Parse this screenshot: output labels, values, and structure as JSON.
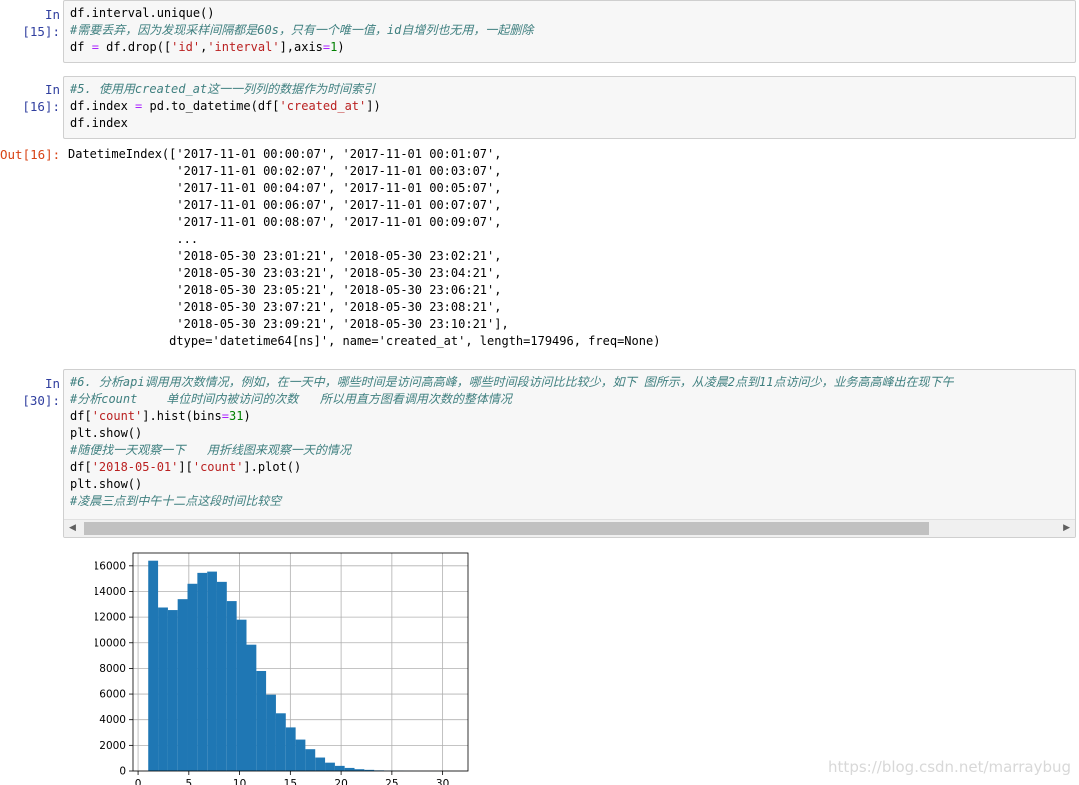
{
  "cells": [
    {
      "prompt": "In [15]:",
      "lines": [
        [
          {
            "t": "df.interval.unique()",
            "c": ""
          }
        ],
        [
          {
            "t": "#需要丢弃，因为发现采样间隔都是60s，只有一个唯一值，id自增列也无用，一起删除",
            "c": "cm"
          }
        ],
        [
          {
            "t": "df ",
            "c": ""
          },
          {
            "t": "=",
            "c": "op"
          },
          {
            "t": " df.drop([",
            "c": ""
          },
          {
            "t": "'id'",
            "c": "st"
          },
          {
            "t": ",",
            "c": ""
          },
          {
            "t": "'interval'",
            "c": "st"
          },
          {
            "t": "],axis",
            "c": ""
          },
          {
            "t": "=",
            "c": "op"
          },
          {
            "t": "1",
            "c": "nu"
          },
          {
            "t": ")",
            "c": ""
          }
        ]
      ]
    },
    {
      "prompt": "In [16]:",
      "lines": [
        [
          {
            "t": "#5. 使用用created_at这一一列列的数据作为时间索引",
            "c": "cm"
          }
        ],
        [
          {
            "t": "df.index ",
            "c": ""
          },
          {
            "t": "=",
            "c": "op"
          },
          {
            "t": " pd.to_datetime(df[",
            "c": ""
          },
          {
            "t": "'created_at'",
            "c": "st"
          },
          {
            "t": "])",
            "c": ""
          }
        ],
        [
          {
            "t": "df.index",
            "c": ""
          }
        ]
      ]
    },
    {
      "prompt": "In [30]:",
      "lines": [
        [
          {
            "t": "#6. 分析api调用用次数情况，例如，在一天中，哪些时间是访问高高峰，哪些时间段访问比比较少，如下 图所示，从凌晨2点到11点访问少，业务高高峰出在现下午",
            "c": "cm"
          }
        ],
        [
          {
            "t": "#分析count    单位时间内被访问的次数   所以用直方图看调用次数的整体情况",
            "c": "cm"
          }
        ],
        [
          {
            "t": "df[",
            "c": ""
          },
          {
            "t": "'count'",
            "c": "st"
          },
          {
            "t": "].hist(bins",
            "c": ""
          },
          {
            "t": "=",
            "c": "op"
          },
          {
            "t": "31",
            "c": "nu"
          },
          {
            "t": ")",
            "c": ""
          }
        ],
        [
          {
            "t": "plt.show()",
            "c": ""
          }
        ],
        [
          {
            "t": "#随便找一天观察一下   用折线图来观察一天的情况",
            "c": "cm"
          }
        ],
        [
          {
            "t": "df[",
            "c": ""
          },
          {
            "t": "'2018-05-01'",
            "c": "st"
          },
          {
            "t": "][",
            "c": ""
          },
          {
            "t": "'count'",
            "c": "st"
          },
          {
            "t": "].plot()",
            "c": ""
          }
        ],
        [
          {
            "t": "plt.show()",
            "c": ""
          }
        ],
        [
          {
            "t": "#凌晨三点到中午十二点这段时间比较空",
            "c": "cm"
          }
        ]
      ]
    }
  ],
  "output16": {
    "prompt": "Out[16]:",
    "lines": [
      "DatetimeIndex(['2017-11-01 00:00:07', '2017-11-01 00:01:07',",
      "               '2017-11-01 00:02:07', '2017-11-01 00:03:07',",
      "               '2017-11-01 00:04:07', '2017-11-01 00:05:07',",
      "               '2017-11-01 00:06:07', '2017-11-01 00:07:07',",
      "               '2017-11-01 00:08:07', '2017-11-01 00:09:07',",
      "               ...",
      "               '2018-05-30 23:01:21', '2018-05-30 23:02:21',",
      "               '2018-05-30 23:03:21', '2018-05-30 23:04:21',",
      "               '2018-05-30 23:05:21', '2018-05-30 23:06:21',",
      "               '2018-05-30 23:07:21', '2018-05-30 23:08:21',",
      "               '2018-05-30 23:09:21', '2018-05-30 23:10:21'],",
      "              dtype='datetime64[ns]', name='created_at', length=179496, freq=None)"
    ]
  },
  "scrollbar": {
    "left_arrow": "◀",
    "right_arrow": "▶"
  },
  "watermark": "https://blog.csdn.net/marraybug",
  "colors": {
    "bar": "#1f77b4",
    "grid": "#b0b0b0"
  },
  "chart_data": {
    "type": "bar",
    "title": "",
    "xlabel": "",
    "ylabel": "",
    "bins": [
      {
        "x0": 1.0,
        "x1": 1.97,
        "count": 16400
      },
      {
        "x0": 1.97,
        "x1": 2.94,
        "count": 12750
      },
      {
        "x0": 2.94,
        "x1": 3.9,
        "count": 12550
      },
      {
        "x0": 3.9,
        "x1": 4.87,
        "count": 13400
      },
      {
        "x0": 4.87,
        "x1": 5.84,
        "count": 14600
      },
      {
        "x0": 5.84,
        "x1": 6.81,
        "count": 15450
      },
      {
        "x0": 6.81,
        "x1": 7.77,
        "count": 15550
      },
      {
        "x0": 7.77,
        "x1": 8.74,
        "count": 14750
      },
      {
        "x0": 8.74,
        "x1": 9.71,
        "count": 13250
      },
      {
        "x0": 9.71,
        "x1": 10.68,
        "count": 11800
      },
      {
        "x0": 10.68,
        "x1": 11.65,
        "count": 9850
      },
      {
        "x0": 11.65,
        "x1": 12.61,
        "count": 7800
      },
      {
        "x0": 12.61,
        "x1": 13.58,
        "count": 5950
      },
      {
        "x0": 13.58,
        "x1": 14.55,
        "count": 4500
      },
      {
        "x0": 14.55,
        "x1": 15.52,
        "count": 3400
      },
      {
        "x0": 15.52,
        "x1": 16.48,
        "count": 2450
      },
      {
        "x0": 16.48,
        "x1": 17.45,
        "count": 1700
      },
      {
        "x0": 17.45,
        "x1": 18.42,
        "count": 1050
      },
      {
        "x0": 18.42,
        "x1": 19.39,
        "count": 650
      },
      {
        "x0": 19.39,
        "x1": 20.35,
        "count": 400
      },
      {
        "x0": 20.35,
        "x1": 21.32,
        "count": 240
      },
      {
        "x0": 21.32,
        "x1": 22.29,
        "count": 140
      },
      {
        "x0": 22.29,
        "x1": 23.26,
        "count": 90
      },
      {
        "x0": 23.26,
        "x1": 24.23,
        "count": 50
      },
      {
        "x0": 24.23,
        "x1": 25.19,
        "count": 30
      },
      {
        "x0": 25.19,
        "x1": 26.16,
        "count": 20
      },
      {
        "x0": 26.16,
        "x1": 27.13,
        "count": 10
      },
      {
        "x0": 27.13,
        "x1": 28.1,
        "count": 5
      },
      {
        "x0": 28.1,
        "x1": 29.06,
        "count": 3
      },
      {
        "x0": 29.06,
        "x1": 30.03,
        "count": 2
      },
      {
        "x0": 30.03,
        "x1": 31.0,
        "count": 1
      }
    ],
    "xlim": [
      -0.5,
      32.5
    ],
    "ylim": [
      0,
      17000
    ],
    "xticks": [
      0,
      5,
      10,
      15,
      20,
      25,
      30
    ],
    "yticks": [
      0,
      2000,
      4000,
      6000,
      8000,
      10000,
      12000,
      14000,
      16000
    ],
    "grid": true
  }
}
